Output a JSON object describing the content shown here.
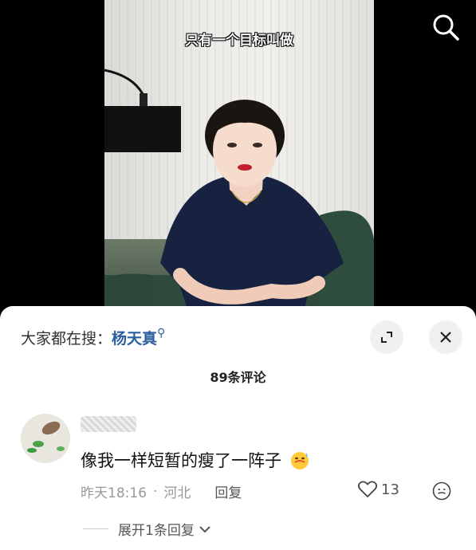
{
  "video": {
    "caption": "只有一个目标叫做"
  },
  "top_bar": {
    "search_icon": "search-icon"
  },
  "sheet": {
    "hot_search_label": "大家都在搜：",
    "hot_search_keyword": "杨天真",
    "expand_icon": "fullscreen-icon",
    "close_icon": "close-icon",
    "comment_count": "89条评论"
  },
  "comments": [
    {
      "text": "像我一样短暂的瘦了一阵子",
      "time": "昨天18:16",
      "location": "河北",
      "reply_label": "回复",
      "likes": "13",
      "expand_replies": "展开1条回复"
    }
  ]
}
